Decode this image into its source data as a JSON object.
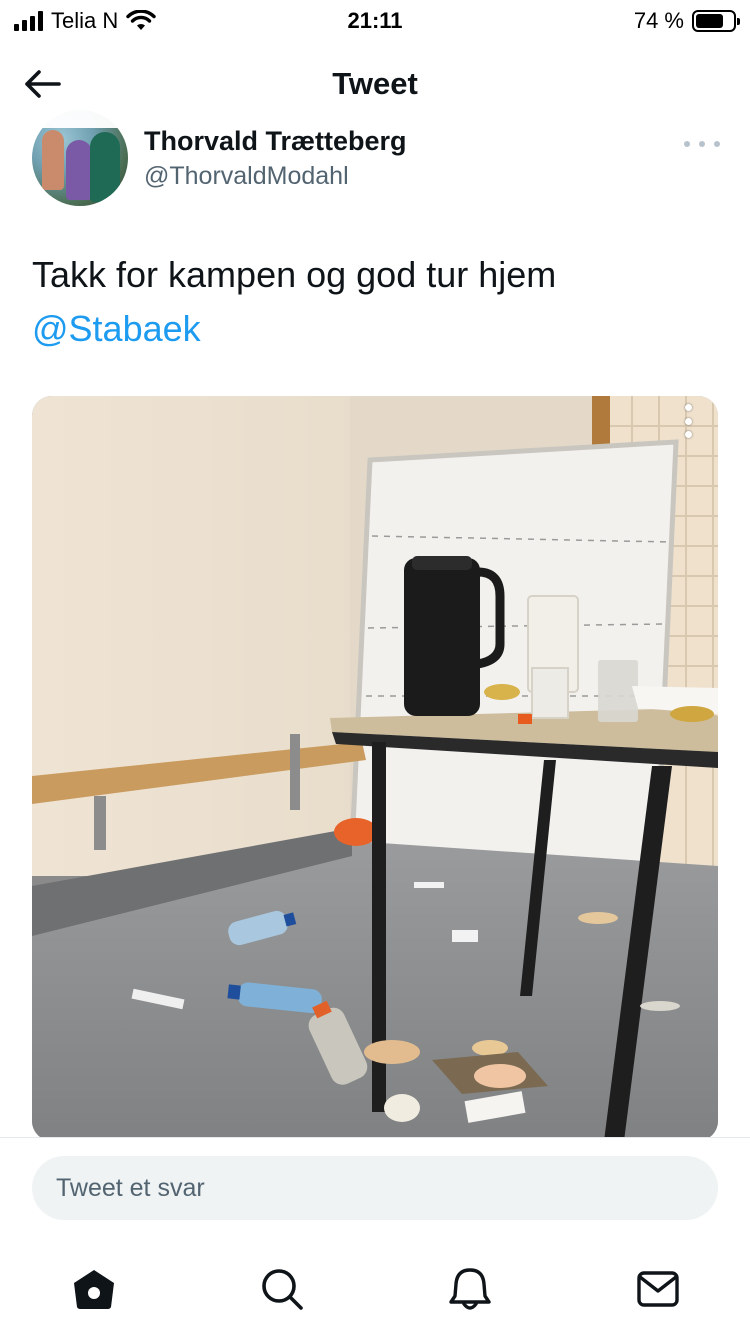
{
  "status_bar": {
    "carrier": "Telia N",
    "time": "21:11",
    "battery_text": "74 %",
    "battery_level": 0.74,
    "icons": [
      "signal-icon",
      "wifi-icon",
      "battery-icon"
    ]
  },
  "header": {
    "title": "Tweet",
    "back_icon": "arrow-left-icon"
  },
  "tweet": {
    "author_name": "Thorvald Trætteberg",
    "author_handle": "@ThorvaldModahl",
    "text": "Takk for kampen og god tur hjem",
    "mention": "@Stabaek",
    "more_icon": "more-horizontal-icon",
    "media_menu_icon": "more-vertical-icon"
  },
  "reply": {
    "placeholder": "Tweet et svar"
  },
  "nav": {
    "items": [
      "home-icon",
      "search-icon",
      "notifications-icon",
      "messages-icon"
    ]
  },
  "colors": {
    "link": "#1d9bf0",
    "text": "#0f1419",
    "secondary": "#536471",
    "reply_bg": "#eff3f4"
  }
}
